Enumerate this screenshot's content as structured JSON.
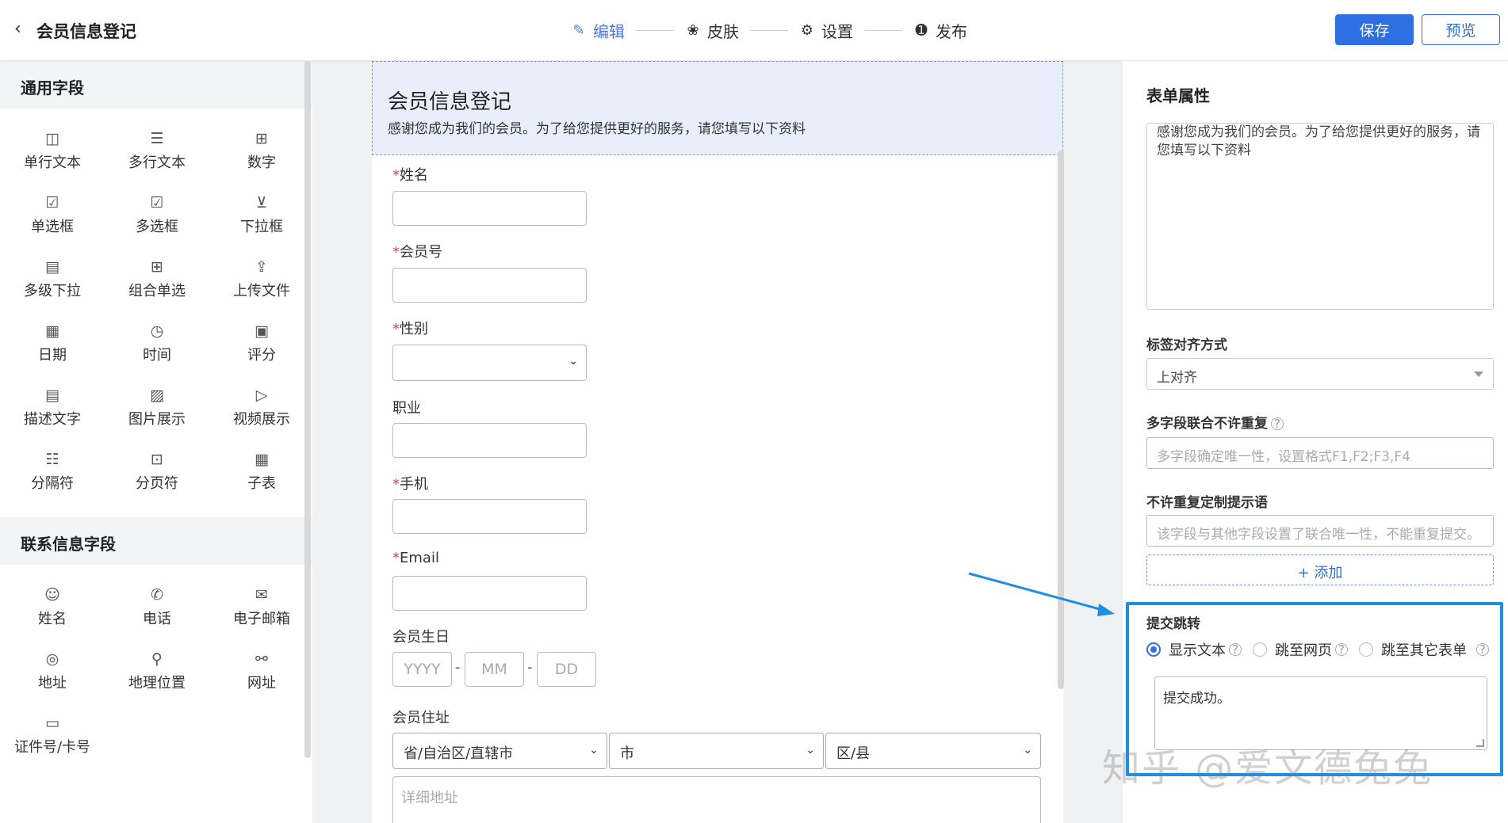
{
  "header": {
    "back_icon": "chevron-left-icon",
    "title": "会员信息登记",
    "steps": [
      {
        "label": "编辑",
        "icon": "✎"
      },
      {
        "label": "皮肤",
        "icon": "❀"
      },
      {
        "label": "设置",
        "icon": "⚙"
      },
      {
        "label": "发布",
        "icon": "➊"
      }
    ],
    "save_label": "保存",
    "preview_label": "预览",
    "accent": "#2f6fe4"
  },
  "left": {
    "general_title": "通用字段",
    "general_items": [
      {
        "label": "单行文本",
        "icon": "◫"
      },
      {
        "label": "多行文本",
        "icon": "☰"
      },
      {
        "label": "数字",
        "icon": "⊞"
      },
      {
        "label": "单选框",
        "icon": "☑"
      },
      {
        "label": "多选框",
        "icon": "☑"
      },
      {
        "label": "下拉框",
        "icon": "⊻"
      },
      {
        "label": "多级下拉",
        "icon": "▤"
      },
      {
        "label": "组合单选",
        "icon": "⊞"
      },
      {
        "label": "上传文件",
        "icon": "⇪"
      },
      {
        "label": "日期",
        "icon": "▦"
      },
      {
        "label": "时间",
        "icon": "◷"
      },
      {
        "label": "评分",
        "icon": "▣"
      },
      {
        "label": "描述文字",
        "icon": "▤"
      },
      {
        "label": "图片展示",
        "icon": "▨"
      },
      {
        "label": "视频展示",
        "icon": "▷"
      },
      {
        "label": "分隔符",
        "icon": "☷"
      },
      {
        "label": "分页符",
        "icon": "⊡"
      },
      {
        "label": "子表",
        "icon": "▦"
      }
    ],
    "contact_title": "联系信息字段",
    "contact_items": [
      {
        "label": "姓名",
        "icon": "☺"
      },
      {
        "label": "电话",
        "icon": "✆"
      },
      {
        "label": "电子邮箱",
        "icon": "✉"
      },
      {
        "label": "地址",
        "icon": "◎"
      },
      {
        "label": "地理位置",
        "icon": "⚲"
      },
      {
        "label": "网址",
        "icon": "⚯"
      },
      {
        "label": "证件号/卡号",
        "icon": "▭"
      }
    ]
  },
  "form": {
    "title": "会员信息登记",
    "description": "感谢您成为我们的会员。为了给您提供更好的服务，请您填写以下资料",
    "fields": {
      "name": "姓名",
      "member_no": "会员号",
      "gender": "性别",
      "job": "职业",
      "phone": "手机",
      "email": "Email",
      "birthday": "会员生日",
      "address": "会员住址"
    },
    "required_mark": "*",
    "date_parts": {
      "year": "YYYY",
      "month": "MM",
      "day": "DD",
      "sep": "-"
    },
    "address_parts": {
      "province": "省/自治区/直辖市",
      "city": "市",
      "district": "区/县",
      "detail_placeholder": "详细地址"
    }
  },
  "props": {
    "title": "表单属性",
    "desc_text": "感谢您成为我们的会员。为了给您提供更好的服务，请您填写以下资料",
    "align_label": "标签对齐方式",
    "align_value": "上对齐",
    "unique_label": "多字段联合不许重复",
    "unique_placeholder": "多字段确定唯一性，设置格式F1,F2;F3,F4",
    "unique_msg_label": "不许重复定制提示语",
    "unique_msg_placeholder": "该字段与其他字段设置了联合唯一性，不能重复提交。",
    "add_label": "+ 添加",
    "jump_label": "提交跳转",
    "jump_options": [
      "显示文本",
      "跳至网页",
      "跳至其它表单"
    ],
    "jump_selected": "显示文本",
    "jump_message": "提交成功。",
    "help_glyph": "?"
  },
  "watermark": "知乎 @爱文德兔兔",
  "highlight_color": "#1e8fe6"
}
